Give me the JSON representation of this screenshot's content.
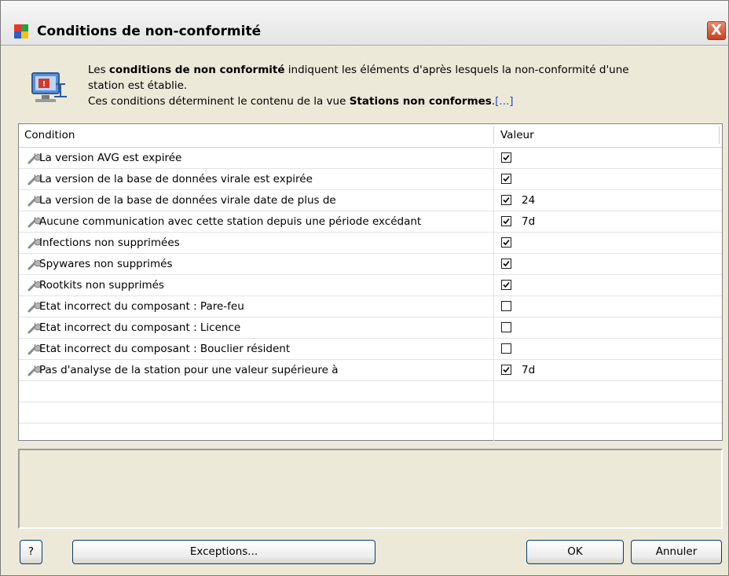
{
  "window": {
    "title": "Conditions de non-conformité",
    "close_label": "X"
  },
  "description": {
    "line1_pre": "Les ",
    "line1_bold": "conditions de non conformité",
    "line1_post": " indiquent les éléments d'après lesquels la non-conformité d'une",
    "line2": "station est établie.",
    "line3_pre": "Ces conditions déterminent le contenu de la vue ",
    "line3_bold": "Stations non conformes",
    "line3_post": ".",
    "more_link": "[...]"
  },
  "table": {
    "headers": {
      "condition": "Condition",
      "value": "Valeur"
    },
    "rows": [
      {
        "label": "La version AVG est expirée",
        "checked": true,
        "value": ""
      },
      {
        "label": "La version de la base de données virale est expirée",
        "checked": true,
        "value": ""
      },
      {
        "label": "La version de la base de données virale date de plus de",
        "checked": true,
        "value": "24"
      },
      {
        "label": "Aucune communication avec cette station depuis une période excédant",
        "checked": true,
        "value": "7d"
      },
      {
        "label": "Infections non supprimées",
        "checked": true,
        "value": ""
      },
      {
        "label": "Spywares non supprimés",
        "checked": true,
        "value": ""
      },
      {
        "label": "Rootkits non supprimés",
        "checked": true,
        "value": ""
      },
      {
        "label": "Etat incorrect du composant : Pare-feu",
        "checked": false,
        "value": ""
      },
      {
        "label": "Etat incorrect du composant : Licence",
        "checked": false,
        "value": ""
      },
      {
        "label": "Etat incorrect du composant : Bouclier résident",
        "checked": false,
        "value": ""
      },
      {
        "label": "Pas d'analyse de la station pour une valeur supérieure à",
        "checked": true,
        "value": "7d"
      }
    ],
    "empty_rows": 3
  },
  "buttons": {
    "help": "?",
    "exceptions": "Exceptions...",
    "ok": "OK",
    "cancel": "Annuler"
  },
  "colors": {
    "link": "#1e4ac5",
    "close": "#c8401b"
  }
}
